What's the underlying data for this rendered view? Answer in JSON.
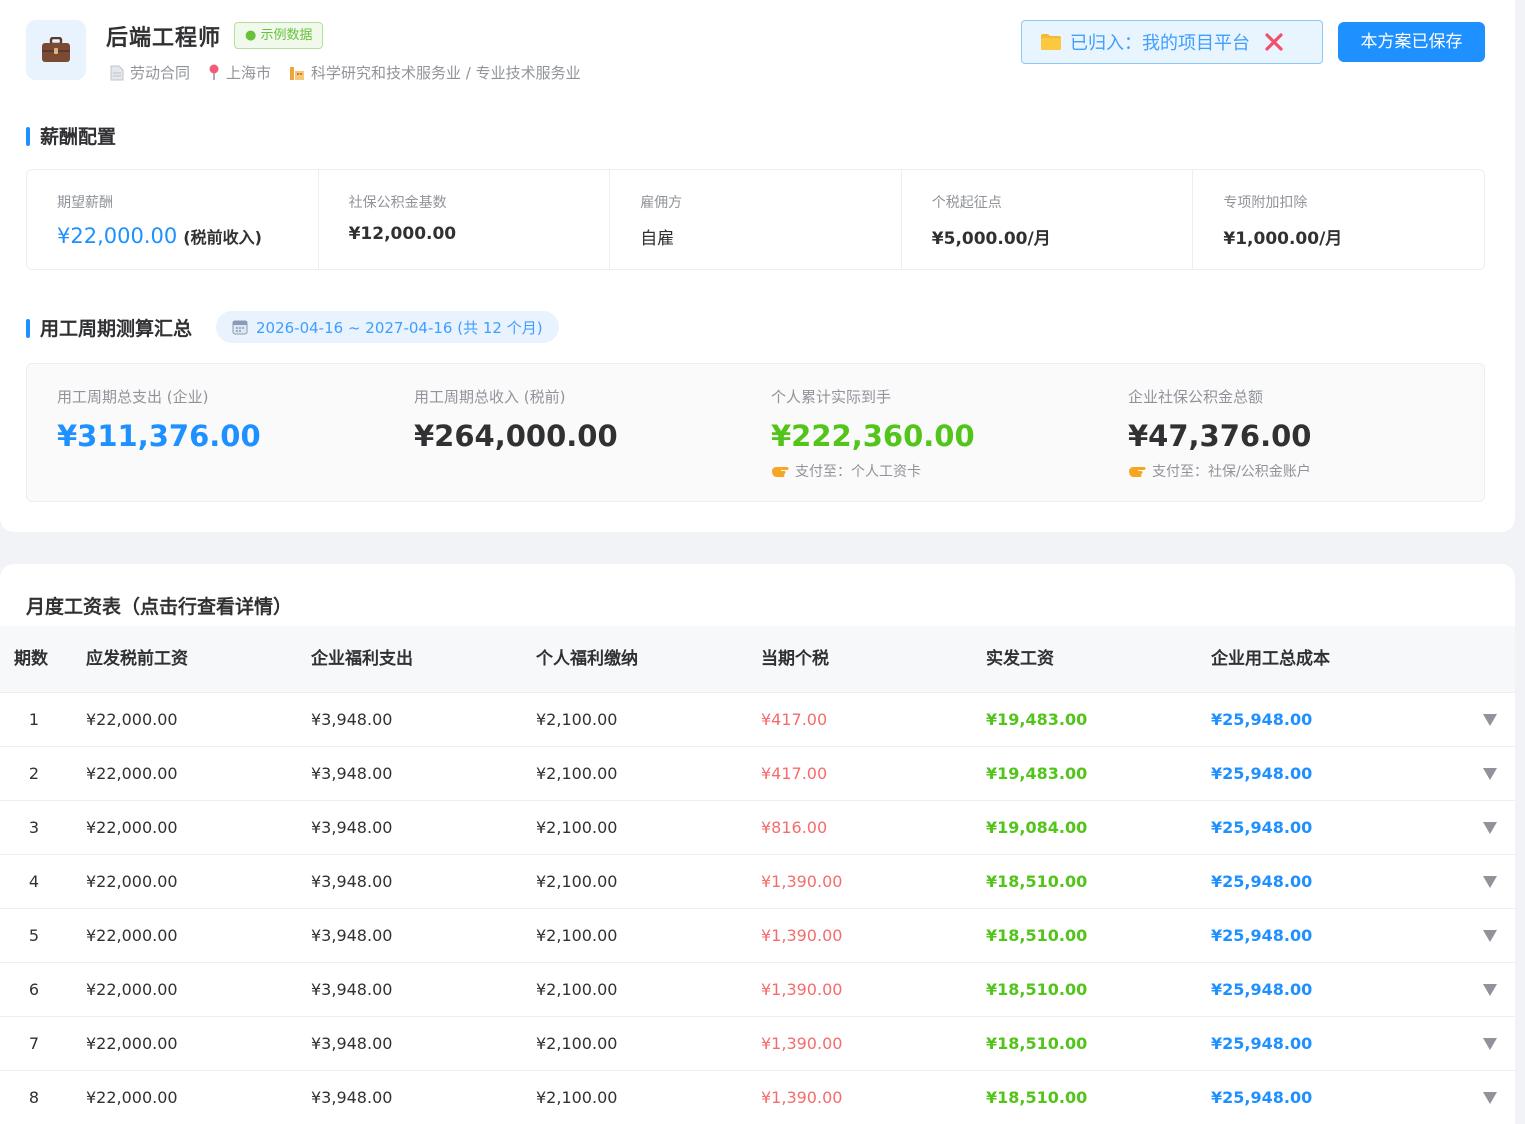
{
  "header": {
    "job_title": "后端工程师",
    "sample_tag": "● 示例数据",
    "contract_type": "劳动合同",
    "city": "上海市",
    "industry": "科学研究和技术服务业 / 专业技术服务业",
    "project_tag": "已归入：我的项目平台",
    "save_button": "本方案已保存"
  },
  "salary_config": {
    "title": "薪酬配置",
    "items": [
      {
        "label": "期望薪酬",
        "value": "¥22,000.00",
        "suffix": "(税前收入)"
      },
      {
        "label": "社保公积金基数",
        "value": "¥12,000.00"
      },
      {
        "label": "雇佣方",
        "value": "自雇"
      },
      {
        "label": "个税起征点",
        "value": "¥5,000.00/月"
      },
      {
        "label": "专项附加扣除",
        "value": "¥1,000.00/月"
      }
    ]
  },
  "period_summary": {
    "title": "用工周期测算汇总",
    "period": "2026-04-16 ~ 2027-04-16 (共 12 个月)",
    "items": [
      {
        "label": "用工周期总支出 (企业)",
        "value": "¥311,376.00",
        "color": "#1e90ff"
      },
      {
        "label": "用工周期总收入 (税前)",
        "value": "¥264,000.00",
        "color": "#303133"
      },
      {
        "label": "个人累计实际到手",
        "value": "¥222,360.00",
        "color": "#52c41a",
        "pay_to": "支付至：个人工资卡"
      },
      {
        "label": "企业社保公积金总额",
        "value": "¥47,376.00",
        "color": "#303133",
        "pay_to": "支付至：社保/公积金账户"
      }
    ]
  },
  "monthly_table": {
    "title": "月度工资表（点击行查看详情）",
    "columns": [
      "期数",
      "应发税前工资",
      "企业福利支出",
      "个人福利缴纳",
      "当期个税",
      "实发工资",
      "企业用工总成本"
    ],
    "rows": [
      [
        "1",
        "¥22,000.00",
        "¥3,948.00",
        "¥2,100.00",
        "¥417.00",
        "¥19,483.00",
        "¥25,948.00"
      ],
      [
        "2",
        "¥22,000.00",
        "¥3,948.00",
        "¥2,100.00",
        "¥417.00",
        "¥19,483.00",
        "¥25,948.00"
      ],
      [
        "3",
        "¥22,000.00",
        "¥3,948.00",
        "¥2,100.00",
        "¥816.00",
        "¥19,084.00",
        "¥25,948.00"
      ],
      [
        "4",
        "¥22,000.00",
        "¥3,948.00",
        "¥2,100.00",
        "¥1,390.00",
        "¥18,510.00",
        "¥25,948.00"
      ],
      [
        "5",
        "¥22,000.00",
        "¥3,948.00",
        "¥2,100.00",
        "¥1,390.00",
        "¥18,510.00",
        "¥25,948.00"
      ],
      [
        "6",
        "¥22,000.00",
        "¥3,948.00",
        "¥2,100.00",
        "¥1,390.00",
        "¥18,510.00",
        "¥25,948.00"
      ],
      [
        "7",
        "¥22,000.00",
        "¥3,948.00",
        "¥2,100.00",
        "¥1,390.00",
        "¥18,510.00",
        "¥25,948.00"
      ],
      [
        "8",
        "¥22,000.00",
        "¥3,948.00",
        "¥2,100.00",
        "¥1,390.00",
        "¥18,510.00",
        "¥25,948.00"
      ]
    ]
  },
  "colors": {
    "accent": "#1e90ff",
    "positive": "#52c41a",
    "tax": "#f56c6c"
  }
}
